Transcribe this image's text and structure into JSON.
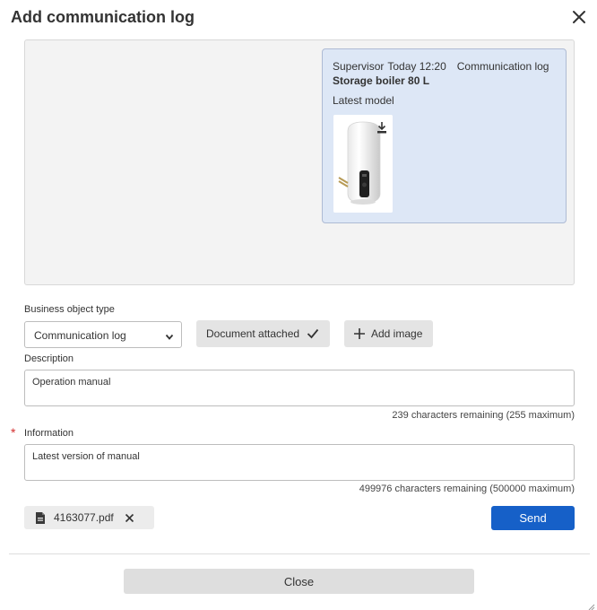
{
  "dialog": {
    "title": "Add communication log",
    "close_icon": "close-icon"
  },
  "preview": {
    "card": {
      "author": "Supervisor",
      "time": "Today 12:20",
      "kind": "Communication log",
      "object_name": "Storage boiler 80 L",
      "note": "Latest model",
      "image_icon": "water-heater-image",
      "download_icon": "download-icon"
    }
  },
  "form": {
    "business_object_type": {
      "label": "Business object type",
      "selected": "Communication log",
      "icon": "chevron-down-icon"
    },
    "document_attached_label": "Document attached",
    "add_image_label": "Add image",
    "description": {
      "label": "Description",
      "value": "Operation manual",
      "counter": "239 characters remaining (255 maximum)"
    },
    "information": {
      "required_marker": "*",
      "label": "Information",
      "value": "Latest version of manual",
      "counter": "499976 characters remaining (500000 maximum)"
    },
    "attachment": {
      "file_name": "4163077.pdf",
      "icon": "file-icon"
    },
    "send_label": "Send"
  },
  "footer": {
    "close_label": "Close"
  },
  "colors": {
    "primary": "#1660c8",
    "card_background": "#dde7f6",
    "required": "#d32f2f"
  }
}
